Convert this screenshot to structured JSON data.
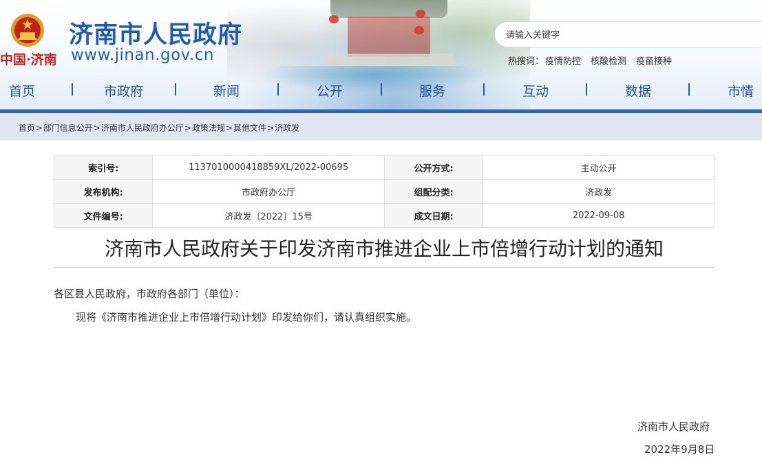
{
  "header": {
    "site_title": "济南市人民政府",
    "site_url": "www.jinan.gov.cn",
    "cn_mark": "中国·济南",
    "search": {
      "placeholder": "请输入关键字"
    },
    "hot_search": {
      "label": "热搜词：",
      "items": [
        "疫情防控",
        "核酸检测",
        "疫苗接种"
      ]
    }
  },
  "nav": {
    "items": [
      "首页",
      "市政府",
      "新闻",
      "公开",
      "服务",
      "互动",
      "数据",
      "市情"
    ]
  },
  "breadcrumb": {
    "items": [
      "首页",
      "部门信息公开",
      "济南市人民政府办公厅",
      "政策法规",
      "其他文件",
      "济政发"
    ],
    "separator": ">"
  },
  "meta": {
    "rows": [
      {
        "k1": "索引号:",
        "v1": "113701000041885 9XL/2022-00695",
        "k2": "公开方式:",
        "v2": "主动公开"
      },
      {
        "k1": "发布机构:",
        "v1": "市政府办公厅",
        "k2": "组配分类:",
        "v2": "济政发"
      },
      {
        "k1": "文件编号:",
        "v1": "济政发〔2022〕15号",
        "k2": "成文日期:",
        "v2": "2022-09-08"
      }
    ]
  },
  "document": {
    "title": "济南市人民政府关于印发济南市推进企业上市倍增行动计划的通知",
    "salutation": "各区县人民政府，市政府各部门（单位）：",
    "body": "现将《济南市推进企业上市倍增行动计划》印发给你们，请认真组织实施。",
    "signature_org": "济南市人民政府",
    "signature_date": "2022年9月8日"
  },
  "colors": {
    "brand_blue": "#1f5bb0",
    "emblem_red": "#c51f1a",
    "nav_underline": "#2c66b8",
    "breadcrumb_bg": "#e1e7f1"
  },
  "icons": [
    "national-emblem-icon"
  ]
}
